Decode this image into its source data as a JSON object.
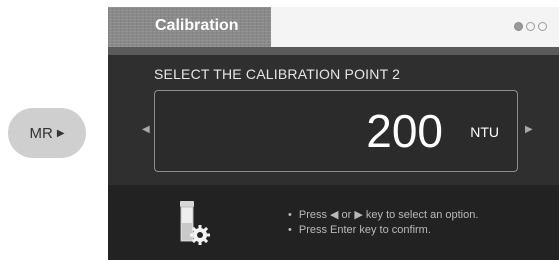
{
  "side_button": {
    "label": "MR",
    "arrow": "▶"
  },
  "window": {
    "title": "Calibration",
    "dots": [
      "filled",
      "empty",
      "empty"
    ]
  },
  "calibration": {
    "prompt": "SELECT THE CALIBRATION POINT 2",
    "value": "200",
    "unit": "NTU",
    "left_arrow": "◀",
    "right_arrow": "▶"
  },
  "instructions": [
    "Press ◀ or ▶ key to select an option.",
    "Press Enter key to confirm."
  ],
  "icons": {
    "vial": "vial-gear-icon",
    "dots": "page-indicator-dots"
  },
  "colors": {
    "panel_bg": "#2f2f2f",
    "title_tab": "#8a8a8a",
    "text": "#ffffff"
  }
}
